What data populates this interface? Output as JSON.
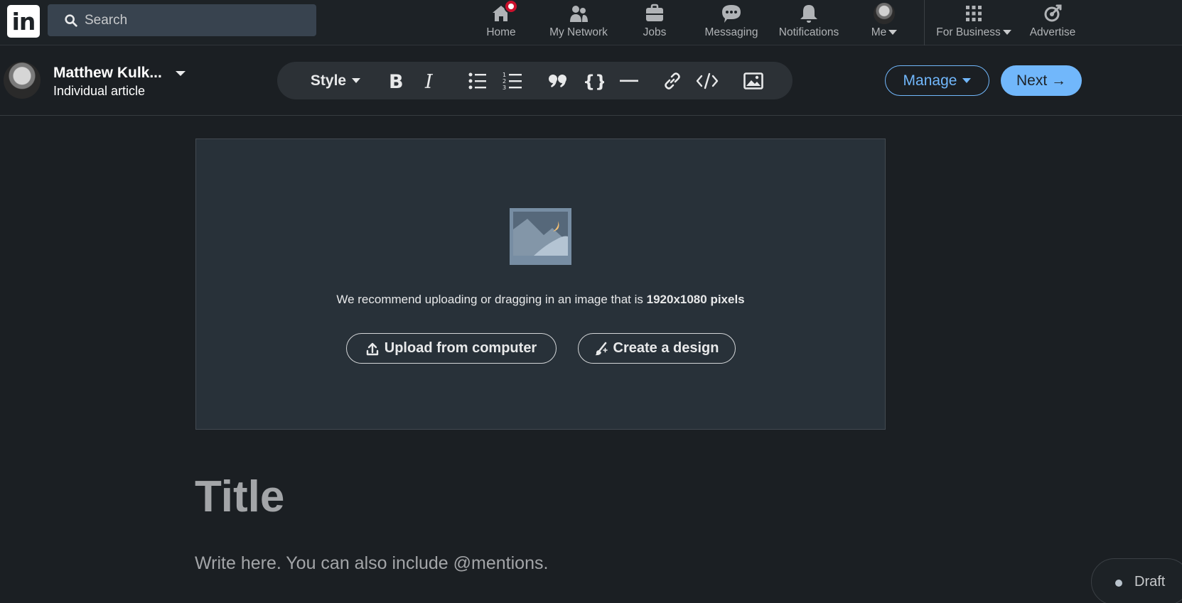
{
  "nav": {
    "logo_text": "in",
    "search_placeholder": "Search",
    "items": [
      {
        "label": "Home",
        "icon": "home-icon"
      },
      {
        "label": "My Network",
        "icon": "people-icon"
      },
      {
        "label": "Jobs",
        "icon": "briefcase-icon"
      },
      {
        "label": "Messaging",
        "icon": "chat-icon"
      },
      {
        "label": "Notifications",
        "icon": "bell-icon"
      },
      {
        "label": "Me",
        "icon": "avatar"
      },
      {
        "label": "For Business",
        "icon": "grid-icon"
      },
      {
        "label": "Advertise",
        "icon": "advertise-icon"
      }
    ]
  },
  "editor": {
    "author_name": "Matthew Kulk...",
    "author_subtitle": "Individual article",
    "toolbar": {
      "style_label": "Style",
      "tools": [
        "bold-icon",
        "italic-icon",
        "bulleted-list-icon",
        "numbered-list-icon",
        "quote-icon",
        "code-block-icon",
        "divider-icon",
        "link-icon",
        "embed-icon",
        "image-icon"
      ]
    },
    "manage_label": "Manage",
    "next_label": "Next →"
  },
  "cover": {
    "recommend_text": "We recommend uploading or dragging in an image that is ",
    "recommend_bold": "1920x1080 pixels",
    "upload_label": "Upload from computer",
    "design_label": "Create a design"
  },
  "content": {
    "title_placeholder": "Title",
    "body_placeholder": "Write here. You can also include @mentions."
  },
  "status": {
    "draft_label": "Draft"
  },
  "colors": {
    "accent": "#71b7fb",
    "background": "#1b1f23",
    "nav_bg": "#1d2226",
    "badge": "#cb112d"
  }
}
